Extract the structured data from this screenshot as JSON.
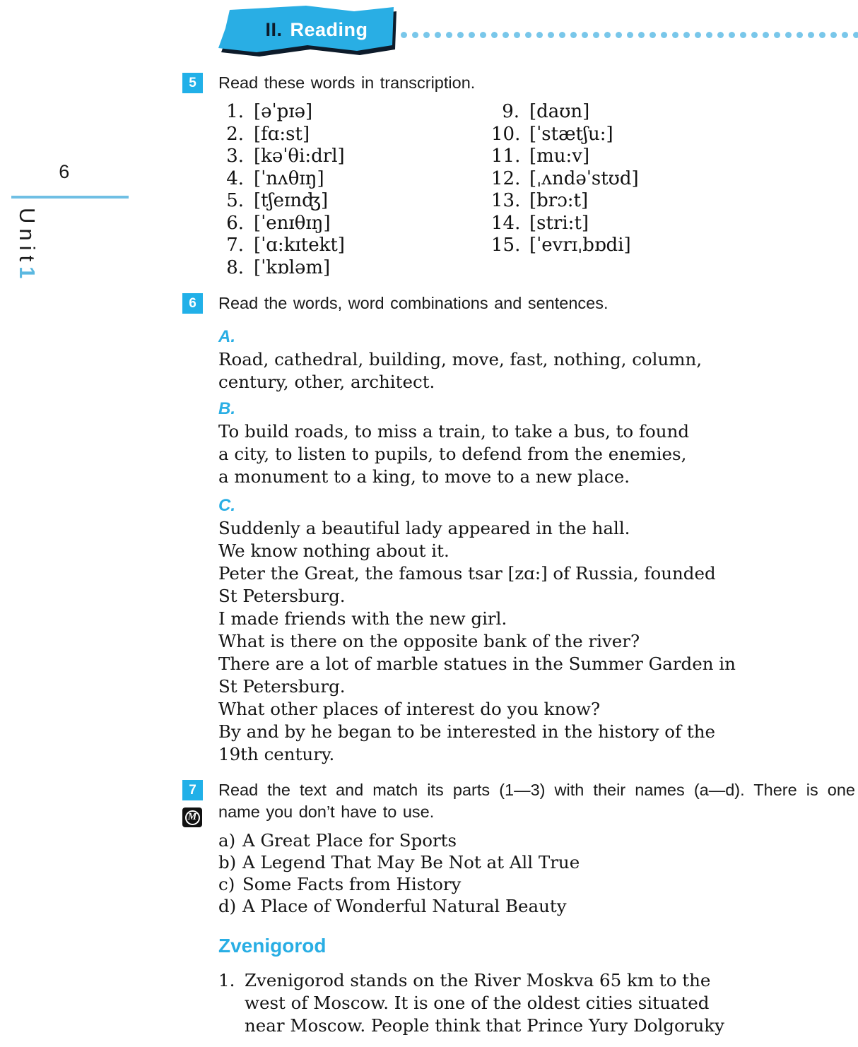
{
  "margin": {
    "page_number": "6",
    "unit_word": "Unit",
    "unit_digit": "1"
  },
  "banner": {
    "number": "II.",
    "title": "Reading",
    "dot_count": 42,
    "colors": {
      "banner_fill": "#29aee4",
      "dot": "#79c7ea",
      "shadow": "#0d1b2a"
    }
  },
  "colors": {
    "accent": "#29aee4",
    "badge": "#21b0e8",
    "rule": "#6fbfe4",
    "text": "#141414"
  },
  "exercises": {
    "ex5": {
      "number": "5",
      "instruction": "Read these words in transcription.",
      "left_column": [
        {
          "n": "1.",
          "t": "[əˈpɪə]"
        },
        {
          "n": "2.",
          "t": "[fɑ:st]"
        },
        {
          "n": "3.",
          "t": "[kəˈθi:drl]"
        },
        {
          "n": "4.",
          "t": "[ˈnʌθɪŋ]"
        },
        {
          "n": "5.",
          "t": "[tʃeɪnʤ]"
        },
        {
          "n": "6.",
          "t": "[ˈenɪθɪŋ]"
        },
        {
          "n": "7.",
          "t": "[ˈɑ:kɪtekt]"
        },
        {
          "n": "8.",
          "t": "[ˈkɒləm]"
        }
      ],
      "right_column": [
        {
          "n": "9.",
          "t": "[daʊn]"
        },
        {
          "n": "10.",
          "t": "[ˈstætʃu:]"
        },
        {
          "n": "11.",
          "t": "[mu:v]"
        },
        {
          "n": "12.",
          "t": "[ˌʌndəˈstʊd]"
        },
        {
          "n": "13.",
          "t": "[brɔ:t]"
        },
        {
          "n": "14.",
          "t": "[stri:t]"
        },
        {
          "n": "15.",
          "t": "[ˈevrɪˌbɒdi]"
        }
      ]
    },
    "ex6": {
      "number": "6",
      "instruction": "Read the words, word combinations and sentences.",
      "part_a": {
        "label": "A.",
        "lines": [
          "Road,  cathedral,  building,  move,  fast,  nothing,  column,",
          "century, other, architect."
        ]
      },
      "part_b": {
        "label": "B.",
        "lines": [
          "To build roads,  to miss a train,  to take a bus,  to found",
          "a  city,  to  listen  to  pupils,  to  defend  from  the  enemies,",
          "a monument to a king, to move to a new place."
        ]
      },
      "part_c": {
        "label": "C.",
        "lines": [
          "Suddenly a beautiful lady appeared in the hall.",
          "We know nothing about it.",
          "Peter the Great, the famous tsar [zɑ:] of Russia, founded",
          "St Petersburg.",
          "I made friends with the new girl.",
          "What is there on the opposite bank of the river?",
          "There are a lot of marble statues in the Summer Garden in",
          "St Petersburg.",
          "What other places of interest do you know?",
          "By and by he began to be interested in the history of the",
          "19th century."
        ]
      }
    },
    "ex7": {
      "number": "7",
      "badge_icon": "m-marker-icon",
      "badge_icon_letter": "M",
      "instruction": "Read the text and match its parts (1—3) with their names (a—d). There is one name you don’t have to use.",
      "names": [
        {
          "key": "a)",
          "label": "A Great Place for Sports"
        },
        {
          "key": "b)",
          "label": "A Legend That May Be Not at All True"
        },
        {
          "key": "c)",
          "label": "Some Facts from History"
        },
        {
          "key": "d)",
          "label": "A Place of Wonderful Natural Beauty"
        }
      ],
      "text_title": "Zvenigorod",
      "paragraph_1": {
        "number": "1.",
        "lines": [
          "Zvenigorod  stands  on  the  River  Moskva  65  km  to  the",
          "west  of  Moscow.  It  is  one  of  the  oldest  cities  situated",
          "near  Moscow.  People  think  that  Prince  Yury  Dolgoruky"
        ]
      }
    }
  }
}
